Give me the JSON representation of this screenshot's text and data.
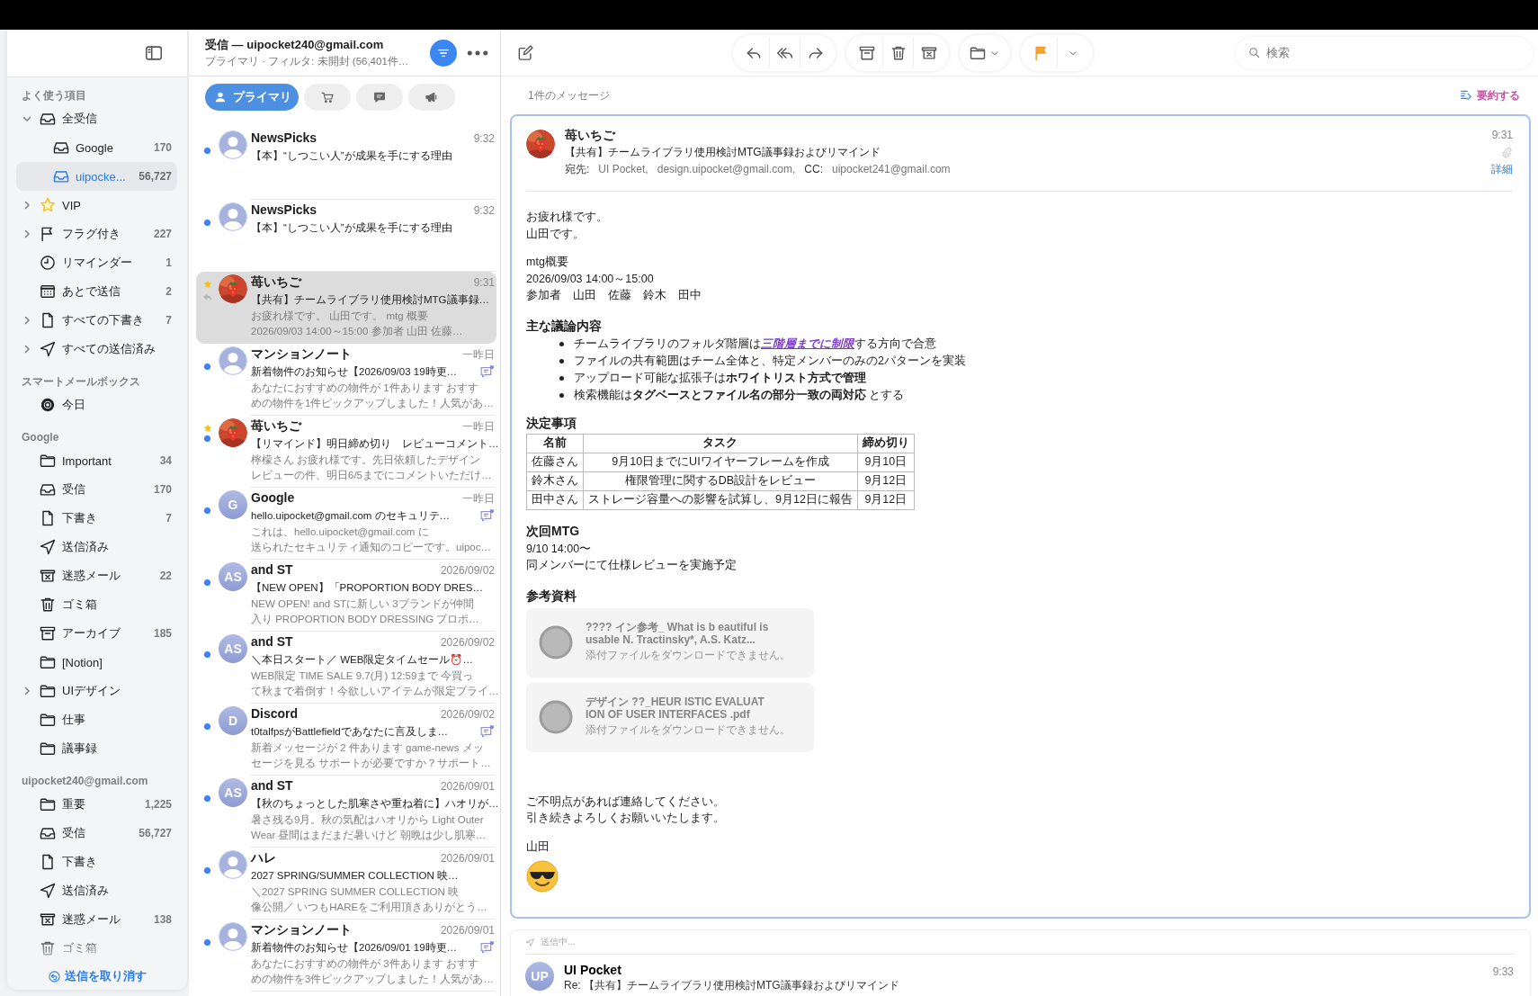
{
  "sidebar": {
    "sections": [
      {
        "title": "よく使う項目",
        "items": [
          {
            "label": "全受信",
            "kind": "all_inboxes",
            "selected": false,
            "expanded": true,
            "children": [
              {
                "label": "Google",
                "kind": "inbox",
                "count": "170",
                "selected": false
              },
              {
                "label": "uipocke...",
                "kind": "inbox",
                "count": "56,727",
                "selected": true
              }
            ]
          },
          {
            "label": "VIP",
            "kind": "vip",
            "selected": false,
            "expanded": false
          },
          {
            "label": "フラグ付き",
            "kind": "flagged",
            "count": "227",
            "selected": false,
            "expanded": false
          },
          {
            "label": "リマインダー",
            "kind": "reminders",
            "count": "1",
            "selected": false
          },
          {
            "label": "あとで送信",
            "kind": "send_later",
            "count": "2",
            "selected": false
          },
          {
            "label": "すべての下書き",
            "kind": "drafts",
            "count": "7",
            "selected": false,
            "expanded": false
          },
          {
            "label": "すべての送信済み",
            "kind": "sent",
            "selected": false,
            "expanded": false
          }
        ]
      },
      {
        "title": "スマートメールボックス",
        "items": [
          {
            "label": "今日",
            "kind": "smart",
            "selected": false
          }
        ]
      },
      {
        "title": "Google",
        "items": [
          {
            "label": "Important",
            "kind": "folder",
            "count": "34",
            "selected": false
          },
          {
            "label": "受信",
            "kind": "inbox",
            "count": "170",
            "selected": false
          },
          {
            "label": "下書き",
            "kind": "drafts",
            "count": "7",
            "selected": false
          },
          {
            "label": "送信済み",
            "kind": "sent",
            "selected": false
          },
          {
            "label": "迷惑メール",
            "kind": "junk",
            "count": "22",
            "selected": false
          },
          {
            "label": "ゴミ箱",
            "kind": "trash",
            "selected": false
          },
          {
            "label": "アーカイブ",
            "kind": "archive",
            "count": "185",
            "selected": false
          },
          {
            "label": "[Notion]",
            "kind": "folder",
            "selected": false
          },
          {
            "label": "UIデザイン",
            "kind": "folder",
            "selected": false,
            "expanded": false
          },
          {
            "label": "仕事",
            "kind": "folder",
            "selected": false
          },
          {
            "label": "議事録",
            "kind": "folder",
            "selected": false
          }
        ]
      },
      {
        "title": "uipocket240@gmail.com",
        "items": [
          {
            "label": "重要",
            "kind": "folder",
            "count": "1,225",
            "selected": false
          },
          {
            "label": "受信",
            "kind": "inbox",
            "count": "56,727",
            "selected": false
          },
          {
            "label": "下書き",
            "kind": "drafts",
            "selected": false
          },
          {
            "label": "送信済み",
            "kind": "sent",
            "selected": false
          },
          {
            "label": "迷惑メール",
            "kind": "junk",
            "count": "138",
            "selected": false
          },
          {
            "label": "ゴミ箱",
            "kind": "trash",
            "selected": false
          }
        ]
      }
    ],
    "undo_button": "送信を取り消す"
  },
  "message_list": {
    "title": "受信 — uipocket240@gmail.com",
    "subtitle": "プライマリ · フィルタ: 未開封 (56,401件…",
    "filter_on": true,
    "tabs": [
      {
        "kind": "primary",
        "label": "プライマリ",
        "selected": true
      },
      {
        "kind": "shopping",
        "selected": false
      },
      {
        "kind": "messages",
        "selected": false
      },
      {
        "kind": "promotions",
        "selected": false
      }
    ],
    "messages": [
      {
        "sender": "NewsPicks",
        "time": "9:32",
        "subject": "【本】“しつこい人”が成果を手にする理由",
        "avatar": {
          "kind": "person"
        },
        "unread": true,
        "starred": false,
        "replied": false,
        "summary": false,
        "selected": false
      },
      {
        "sender": "NewsPicks",
        "time": "9:32",
        "subject": "【本】“しつこい人”が成果を手にする理由",
        "avatar": {
          "kind": "person"
        },
        "unread": true,
        "starred": false,
        "replied": false,
        "summary": false,
        "selected": false
      },
      {
        "sender": "苺いちご",
        "time": "9:31",
        "subject": "【共有】チームライブラリ使用検討MTG議事録…",
        "preview": [
          "お疲れ様です。 山田です。 mtg 概要",
          "2026/09/03 14:00～15:00 参加者 山田 佐藤…"
        ],
        "avatar": {
          "kind": "picture"
        },
        "unread": false,
        "starred": true,
        "replied": true,
        "summary": false,
        "selected": true
      },
      {
        "sender": "マンションノート",
        "time": "一昨日",
        "subject": "新着物件のお知らせ【2026/09/03 19時更…",
        "preview": [
          "あなたにおすすめの物件が 1件あります おすす",
          "めの物件を1件ピックアップしました！人気があ…"
        ],
        "avatar": {
          "kind": "person"
        },
        "unread": true,
        "starred": false,
        "replied": false,
        "summary": true,
        "selected": false
      },
      {
        "sender": "苺いちご",
        "time": "一昨日",
        "subject": "【リマインド】明日締め切り　レビューコメント…",
        "preview": [
          "檸檬さん お疲れ様です。先日依頼したデザイン",
          "レビューの件、明日6/5までにコメントいただけ…"
        ],
        "avatar": {
          "kind": "picture"
        },
        "unread": true,
        "starred": true,
        "replied": false,
        "summary": false,
        "selected": false
      },
      {
        "sender": "Google",
        "time": "一昨日",
        "subject": "hello.uipocket@gmail.com のセキュリテ…",
        "preview": [
          "これは、hello.uipocket@gmail.com に",
          "送られたセキュリティ通知のコピーです。uipoc…"
        ],
        "avatar": {
          "kind": "initials",
          "text": "G"
        },
        "unread": true,
        "starred": false,
        "replied": false,
        "summary": true,
        "selected": false
      },
      {
        "sender": "and ST",
        "time": "2026/09/02",
        "subject": "【NEW OPEN】「PROPORTION BODY DRES…",
        "preview": [
          "NEW OPEN! and STに新しい 3ブランドが仲間",
          "入り PROPORTION BODY DRESSING プロポ…"
        ],
        "avatar": {
          "kind": "initials",
          "text": "AS"
        },
        "unread": true,
        "starred": false,
        "replied": false,
        "summary": false,
        "selected": false
      },
      {
        "sender": "and ST",
        "time": "2026/09/02",
        "subject": "＼本日スタート／ WEB限定タイムセール⏰…",
        "preview": [
          "WEB限定 TIME SALE 9.7(月) 12:59まで 今買っ",
          "て秋まで着倒す！今欲しいアイテムが限定プライ…"
        ],
        "avatar": {
          "kind": "initials",
          "text": "AS"
        },
        "unread": true,
        "starred": false,
        "replied": false,
        "summary": false,
        "selected": false
      },
      {
        "sender": "Discord",
        "time": "2026/09/02",
        "subject": "t0talfpsがBattlefieldであなたに言及しま…",
        "preview": [
          "新着メッセージが 2 件あります game-news メッ",
          "セージを見る サポートが必要ですか？サポート…"
        ],
        "avatar": {
          "kind": "initials",
          "text": "D"
        },
        "unread": true,
        "starred": false,
        "replied": false,
        "summary": true,
        "selected": false
      },
      {
        "sender": "and ST",
        "time": "2026/09/01",
        "subject": "【秋のちょっとした肌寒さや重ね着に】ハオリが…",
        "preview": [
          "暑さ残る9月。秋の気配はハオリから Light Outer",
          "Wear 昼間はまだまだ暑いけど 朝晩は少し肌寒…"
        ],
        "avatar": {
          "kind": "initials",
          "text": "AS"
        },
        "unread": true,
        "starred": false,
        "replied": false,
        "summary": false,
        "selected": false
      },
      {
        "sender": "ハレ",
        "time": "2026/09/01",
        "subject": "2027 SPRING/SUMMER COLLECTION 映…",
        "preview": [
          "＼2027 SPRING SUMMER COLLECTION 映",
          "像公開／ いつもHAREをご利用頂きありがとう…"
        ],
        "avatar": {
          "kind": "person"
        },
        "unread": true,
        "starred": false,
        "replied": false,
        "summary": false,
        "selected": false
      },
      {
        "sender": "マンションノート",
        "time": "2026/09/01",
        "subject": "新着物件のお知らせ【2026/09/01 19時更…",
        "preview": [
          "あなたにおすすめの物件が 3件あります おすす",
          "めの物件を3件ピックアップしました！人気があ…"
        ],
        "avatar": {
          "kind": "person"
        },
        "unread": true,
        "starred": false,
        "replied": false,
        "summary": true,
        "selected": false
      }
    ]
  },
  "reader": {
    "search": {
      "placeholder": "検索"
    },
    "count_label": "1件のメッセージ",
    "summarize": "要約する",
    "message": {
      "sender": "苺いちご",
      "time": "9:31",
      "subject": "【共有】チームライブラリ使用検討MTG議事録およびリマインド",
      "to_label": "宛先:",
      "to": [
        "UI Pocket,",
        "design.uipocket@gmail.com,"
      ],
      "cc_label": "CC:",
      "cc": [
        "uipocket241@gmail.com"
      ],
      "has_attachment": true,
      "details": "詳細",
      "body": [
        {
          "kind": "text",
          "lines": [
            "お疲れ様です。",
            "山田です。"
          ]
        },
        {
          "kind": "text",
          "lines": [
            "mtg概要",
            "2026/09/03 14:00～15:00",
            "参加者　山田　佐藤　鈴木　田中"
          ]
        },
        {
          "kind": "heading",
          "text": "主な議論内容"
        },
        {
          "kind": "bullets",
          "items": [
            {
              "before": "チームライブラリのフォルダ階層は",
              "link": "三階層までに制限",
              "after": "する方向で合意"
            },
            {
              "text": "ファイルの共有範囲はチーム全体と、特定メンバーのみの2パターンを実装"
            },
            {
              "text": "アップロード可能な拡張子は**ホワイトリスト方式で管理**"
            },
            {
              "text": "検索機能は**タグベースとファイル名の部分一致の両対応** とする"
            }
          ]
        },
        {
          "kind": "heading",
          "text": "決定事項"
        },
        {
          "kind": "table",
          "columns": [
            "名前",
            "タスク",
            "締め切り"
          ],
          "rows": [
            [
              "佐藤さん",
              "9月10日までにUIワイヤーフレームを作成",
              "9月10日"
            ],
            [
              "鈴木さん",
              "権限管理に関するDB設計をレビュー",
              "9月12日"
            ],
            [
              "田中さん",
              "ストレージ容量への影響を試算し、9月12日に報告",
              "9月12日"
            ]
          ]
        },
        {
          "kind": "heading",
          "text": "次回MTG"
        },
        {
          "kind": "text",
          "lines": [
            "9/10 14:00〜",
            "同メンバーにて仕様レビューを実施予定"
          ]
        },
        {
          "kind": "heading",
          "text": "参考資料"
        },
        {
          "kind": "attachments",
          "items": [
            {
              "name": [
                "???? イン参考_ What is b eautiful is",
                "usable N. Tractinsky*, A.S. Katz..."
              ],
              "note": "添付ファイルをダウンロードできません。"
            },
            {
              "name": [
                "デザイン ??_HEUR ISTIC EVALUAT",
                "ION OF USER INTERFACES .pdf"
              ],
              "note": "添付ファイルをダウンロードできません。"
            }
          ]
        },
        {
          "kind": "text",
          "lines": [
            "ご不明点があれば連絡してください。",
            "引き続きよろしくお願いいたします。"
          ]
        },
        {
          "kind": "text",
          "lines": [
            "山田"
          ]
        },
        {
          "kind": "emoji"
        }
      ]
    },
    "draft": {
      "status": "送信中...",
      "initials": "UP",
      "sender": "UI Pocket",
      "time": "9:33",
      "subject": "Re: 【共有】チームライブラリ使用検討MTG議事録およびリマインド"
    }
  }
}
